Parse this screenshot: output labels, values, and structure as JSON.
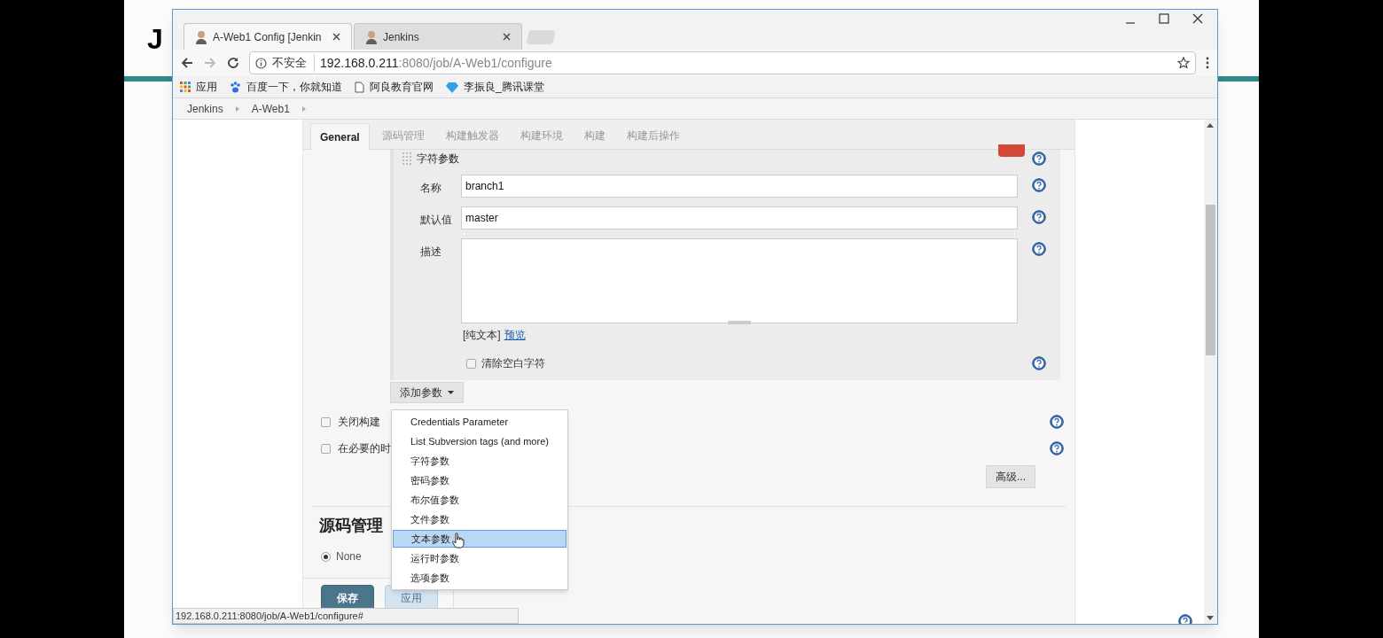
{
  "background": {
    "text": "J"
  },
  "browser": {
    "tabs": [
      {
        "title": "A-Web1 Config [Jenkin",
        "selected": true
      },
      {
        "title": "Jenkins",
        "selected": false
      }
    ],
    "security": "不安全",
    "url_host": "192.168.0.211",
    "url_rest": ":8080/job/A-Web1/configure",
    "bookmarks": [
      {
        "label": "应用",
        "kind": "apps"
      },
      {
        "label": "百度一下，你就知道",
        "kind": "paw"
      },
      {
        "label": "阿良教育官网",
        "kind": "page"
      },
      {
        "label": "李振良_腾讯课堂",
        "kind": "gem"
      }
    ],
    "status_url": "192.168.0.211:8080/job/A-Web1/configure#"
  },
  "breadcrumbs": [
    "Jenkins",
    "A-Web1"
  ],
  "config_tabs": [
    {
      "label": "General",
      "selected": true
    },
    {
      "label": "源码管理",
      "selected": false
    },
    {
      "label": "构建触发器",
      "selected": false
    },
    {
      "label": "构建环境",
      "selected": false
    },
    {
      "label": "构建",
      "selected": false
    },
    {
      "label": "构建后操作",
      "selected": false
    }
  ],
  "parameter": {
    "title": "字符参数",
    "fields": [
      {
        "label": "名称",
        "value": "branch1",
        "kind": "input"
      },
      {
        "label": "默认值",
        "value": "master",
        "kind": "input"
      },
      {
        "label": "描述",
        "kind": "textarea"
      }
    ],
    "format": "[纯文本]",
    "preview_link": "预览",
    "trim": {
      "label": "清除空白字符",
      "checked": false
    }
  },
  "add_button": "添加参数",
  "menu": [
    {
      "label": "Credentials Parameter",
      "selected": false
    },
    {
      "label": "List Subversion tags (and more)",
      "selected": false
    },
    {
      "label": "字符参数",
      "selected": false
    },
    {
      "label": "密码参数",
      "selected": false
    },
    {
      "label": "布尔值参数",
      "selected": false
    },
    {
      "label": "文件参数",
      "selected": false
    },
    {
      "label": "文本参数",
      "selected": true
    },
    {
      "label": "运行时参数",
      "selected": false
    },
    {
      "label": "选项参数",
      "selected": false
    }
  ],
  "options": [
    {
      "label": "关闭构建",
      "checked": false
    },
    {
      "label": "在必要的时",
      "checked": false
    }
  ],
  "advanced_button": "高级...",
  "scm": {
    "heading": "源码管理",
    "radio": {
      "label": "None",
      "selected": true
    }
  },
  "buttons": [
    {
      "label": "保存",
      "kind": "primary"
    },
    {
      "label": "应用",
      "kind": "secondary"
    }
  ]
}
